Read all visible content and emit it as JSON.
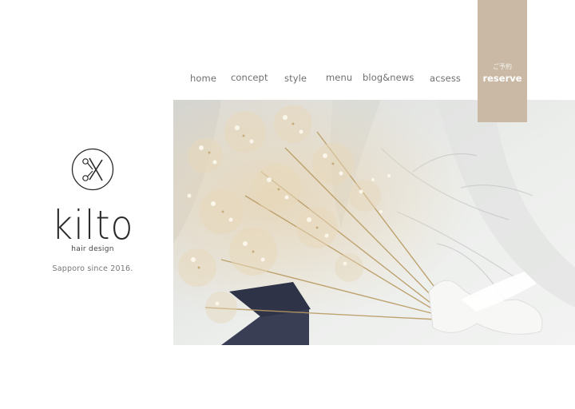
{
  "nav": {
    "items": [
      {
        "label": "home"
      },
      {
        "label": "concept"
      },
      {
        "label": "style"
      },
      {
        "label": "menu"
      },
      {
        "label": "blog&news"
      },
      {
        "label": "acsess"
      }
    ]
  },
  "reserve": {
    "label_jp": "ご予約",
    "label_en": "reserve"
  },
  "brand": {
    "name": "kilto",
    "subtitle": "hair design",
    "since": "Sapporo since 2016.",
    "logo_icon": "scissors-circle-icon"
  },
  "hero": {
    "image": "dried-baby's-breath-bouquet-photo"
  },
  "colors": {
    "accent": "#c9b9a5",
    "text": "#6f6f6f",
    "logo": "#2a2a2a"
  }
}
